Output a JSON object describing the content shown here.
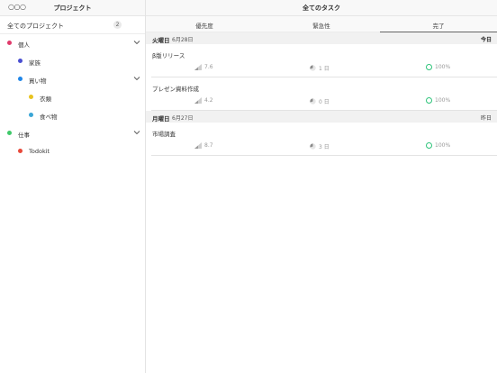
{
  "sidebar": {
    "more_label": "○○○",
    "title": "プロジェクト",
    "all_projects": {
      "label": "全てのプロジェクト",
      "count": "2"
    },
    "projects": [
      {
        "label": "個人",
        "color": "#e03a6b",
        "level": 0,
        "expanded": true
      },
      {
        "label": "家族",
        "color": "#4a4fd1",
        "level": 1,
        "expanded": false
      },
      {
        "label": "買い物",
        "color": "#1f86e8",
        "level": 1,
        "expanded": true
      },
      {
        "label": "衣類",
        "color": "#e8c31f",
        "level": 2,
        "expanded": false
      },
      {
        "label": "食べ物",
        "color": "#3aa6d6",
        "level": 2,
        "expanded": false
      },
      {
        "label": "仕事",
        "color": "#3fc96a",
        "level": 0,
        "expanded": true
      },
      {
        "label": "Todokit",
        "color": "#e8493a",
        "level": 1,
        "expanded": false
      }
    ]
  },
  "main": {
    "title": "全てのタスク",
    "tabs": [
      {
        "label": "優先度",
        "active": false
      },
      {
        "label": "緊急性",
        "active": false
      },
      {
        "label": "完了",
        "active": true
      }
    ],
    "groups": [
      {
        "day": "火曜日",
        "date": "6月28日",
        "relative": "今日",
        "relative_bold": true,
        "tasks": [
          {
            "name": "β版リリース",
            "priority": "7.6",
            "urgency": "1 日",
            "done": "100%"
          },
          {
            "name": "プレゼン資料作成",
            "priority": "4.2",
            "urgency": "0 日",
            "done": "100%"
          }
        ]
      },
      {
        "day": "月曜日",
        "date": "6月27日",
        "relative": "昨日",
        "relative_bold": false,
        "tasks": [
          {
            "name": "市場調査",
            "priority": "8.7",
            "urgency": "3 日",
            "done": "100%"
          }
        ]
      }
    ]
  },
  "colors": {
    "done_ring": "#2ec47a",
    "muted_text": "#999999"
  }
}
